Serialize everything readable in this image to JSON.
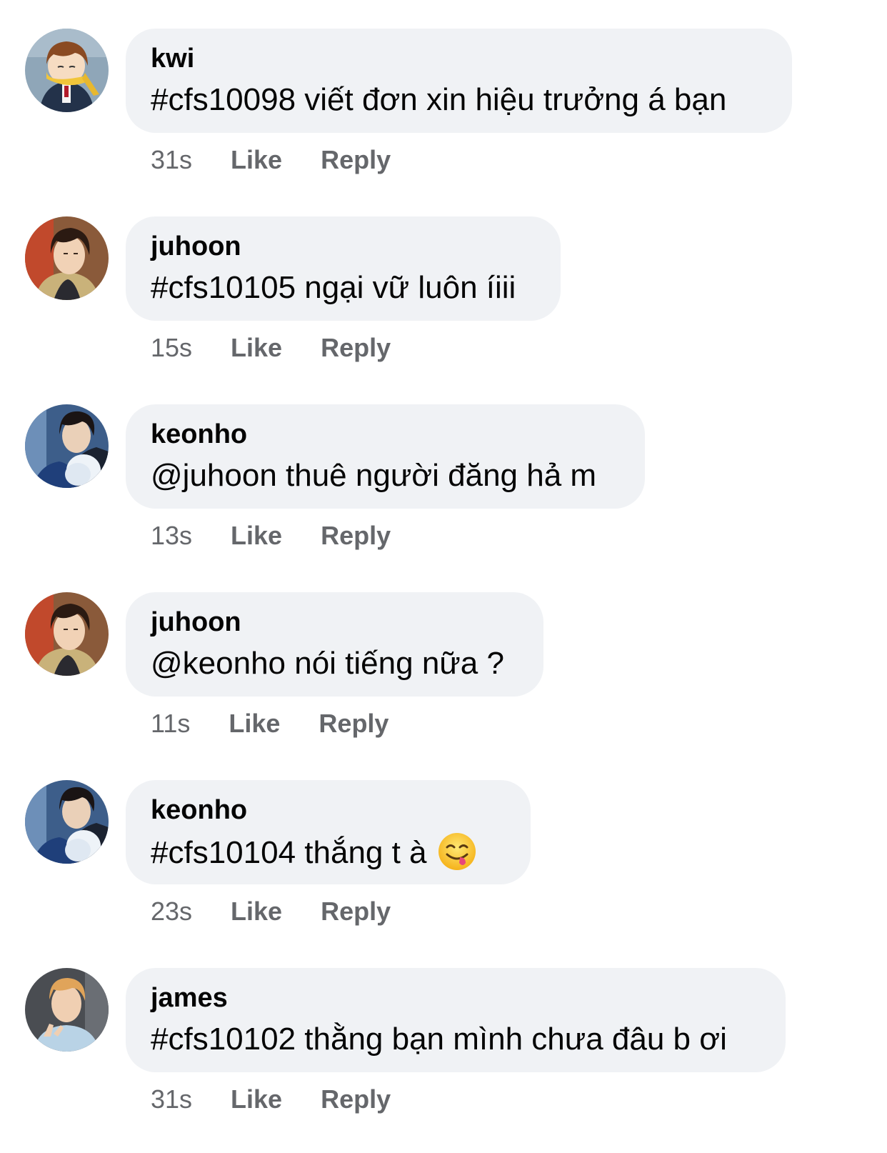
{
  "comments": [
    {
      "author": "kwi",
      "text": "#cfs10098 viết đơn xin hiệu trưởng á bạn",
      "time": "31s",
      "like": "Like",
      "reply": "Reply"
    },
    {
      "author": "juhoon",
      "text": "#cfs10105 ngại vữ luôn íiii",
      "time": "15s",
      "like": "Like",
      "reply": "Reply"
    },
    {
      "author": "keonho",
      "text": "@juhoon thuê người đăng hả m",
      "time": "13s",
      "like": "Like",
      "reply": "Reply"
    },
    {
      "author": "juhoon",
      "text": "@keonho nói tiếng nữa ?",
      "time": "11s",
      "like": "Like",
      "reply": "Reply"
    },
    {
      "author": "keonho",
      "text": "#cfs10104 thắng t à",
      "time": "23s",
      "like": "Like",
      "reply": "Reply",
      "emoji": "yum-face-emoji"
    },
    {
      "author": "james",
      "text": "#cfs10102 thằng bạn mình chưa đâu b ơi",
      "time": "31s",
      "like": "Like",
      "reply": "Reply"
    }
  ],
  "colors": {
    "bubble": "#f0f2f5",
    "meta_text": "#65676b",
    "body_text": "#050505"
  }
}
